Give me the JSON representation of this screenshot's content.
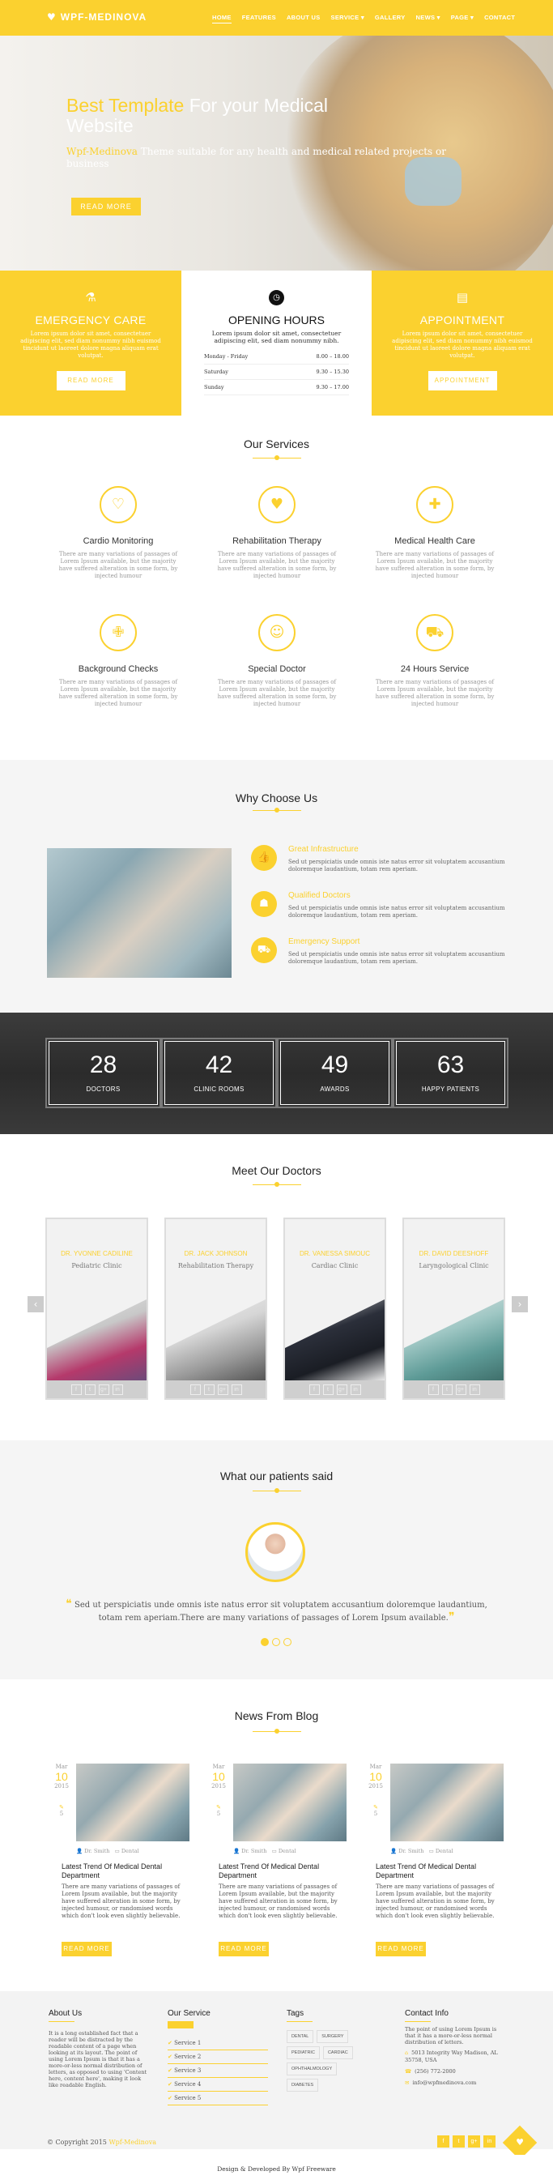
{
  "header": {
    "logo": "WPF-MEDINOVA",
    "nav": [
      "HOME",
      "FEATURES",
      "ABOUT US",
      "SERVICE ▾",
      "GALLERY",
      "NEWS ▾",
      "PAGE ▾",
      "CONTACT"
    ]
  },
  "hero": {
    "title_accent": "Best Template",
    "title_rest": " For your Medical",
    "title_line2": "Website",
    "sub_accent": "Wpf-Medinova",
    "sub_rest": " Theme suitable for any health and medical related projects or business",
    "button": "READ MORE"
  },
  "emergency": {
    "title": "EMERGENCY CARE",
    "text": "Lorem ipsum dolor sit amet, consectetuer adipiscing elit, sed diam nonummy nibh euismod tincidunt ut laoreet dolore magna aliquam erat volutpat.",
    "button": "READ MORE"
  },
  "hours": {
    "title": "OPENING HOURS",
    "text": "Lorem ipsum dolor sit amet, consectetuer adipiscing elit, sed diam nonummy nibh.",
    "rows": [
      {
        "day": "Monday - Friday",
        "time": "8.00 – 18.00"
      },
      {
        "day": "Saturday",
        "time": "9.30 – 15.30"
      },
      {
        "day": "Sunday",
        "time": "9.30 – 17.00"
      }
    ]
  },
  "appointment": {
    "title": "APPOINTMENT",
    "text": "Lorem ipsum dolor sit amet, consectetuer adipiscing elit, sed diam nonummy nibh euismod tincidunt ut laoreet dolore magna aliquam erat volutpat.",
    "button": "APPOINTMENT"
  },
  "services": {
    "title": "Our Services",
    "items": [
      {
        "name": "Cardio Monitoring",
        "text": "There are many variations of passages of Lorem Ipsum available, but the majority have suffered alteration in some form, by injected humour"
      },
      {
        "name": "Rehabilitation Therapy",
        "text": "There are many variations of passages of Lorem Ipsum available, but the majority have suffered alteration in some form, by injected humour"
      },
      {
        "name": "Medical Health Care",
        "text": "There are many variations of passages of Lorem Ipsum available, but the majority have suffered alteration in some form, by injected humour"
      },
      {
        "name": "Background Checks",
        "text": "There are many variations of passages of Lorem Ipsum available, but the majority have suffered alteration in some form, by injected humour"
      },
      {
        "name": "Special Doctor",
        "text": "There are many variations of passages of Lorem Ipsum available, but the majority have suffered alteration in some form, by injected humour"
      },
      {
        "name": "24 Hours Service",
        "text": "There are many variations of passages of Lorem Ipsum available, but the majority have suffered alteration in some form, by injected humour"
      }
    ]
  },
  "why": {
    "title": "Why Choose Us",
    "items": [
      {
        "title": "Great Infrastructure",
        "text": "Sed ut perspiciatis unde omnis iste natus error sit voluptatem accusantium doloremque laudantium, totam rem aperiam."
      },
      {
        "title": "Qualified Doctors",
        "text": "Sed ut perspiciatis unde omnis iste natus error sit voluptatem accusantium doloremque laudantium, totam rem aperiam."
      },
      {
        "title": "Emergency Support",
        "text": "Sed ut perspiciatis unde omnis iste natus error sit voluptatem accusantium doloremque laudantium, totam rem aperiam."
      }
    ]
  },
  "stats": [
    {
      "num": "28",
      "label": "DOCTORS"
    },
    {
      "num": "42",
      "label": "CLINIC ROOMS"
    },
    {
      "num": "49",
      "label": "AWARDS"
    },
    {
      "num": "63",
      "label": "HAPPY PATIENTS"
    }
  ],
  "doctors": {
    "title": "Meet Our Doctors",
    "items": [
      {
        "name": "DR. YVONNE CADILINE",
        "spec": "Pediatric Clinic"
      },
      {
        "name": "DR. JACK JOHNSON",
        "spec": "Rehabilitation Therapy"
      },
      {
        "name": "DR. VANESSA SIMOUC",
        "spec": "Cardiac Clinic"
      },
      {
        "name": "DR. DAVID DEESHOFF",
        "spec": "Laryngological Clinic"
      }
    ],
    "social": [
      "f",
      "t",
      "g+",
      "in"
    ]
  },
  "testimonials": {
    "title": "What our patients said",
    "quote": "Sed ut perspiciatis unde omnis iste natus error sit voluptatem accusantium doloremque laudantium, totam rem aperiam.There are many variations of passages of Lorem Ipsum available."
  },
  "blog": {
    "title": "News From Blog",
    "posts": [
      {
        "month": "Mar",
        "day": "10",
        "year": "2015",
        "comments": "5",
        "author": "Dr. Smith",
        "cat": "Dental",
        "title": "Latest Trend Of Medical Dental Department",
        "text": "There are many variations of passages of Lorem Ipsum available, but the majority have suffered alteration in some form, by injected humour, or randomised words which don't look even slightly believable.",
        "button": "READ MORE"
      },
      {
        "month": "Mar",
        "day": "10",
        "year": "2015",
        "comments": "5",
        "author": "Dr. Smith",
        "cat": "Dental",
        "title": "Latest Trend Of Medical Dental Department",
        "text": "There are many variations of passages of Lorem Ipsum available, but the majority have suffered alteration in some form, by injected humour, or randomised words which don't look even slightly believable.",
        "button": "READ MORE"
      },
      {
        "month": "Mar",
        "day": "10",
        "year": "2015",
        "comments": "5",
        "author": "Dr. Smith",
        "cat": "Dental",
        "title": "Latest Trend Of Medical Dental Department",
        "text": "There are many variations of passages of Lorem Ipsum available, but the majority have suffered alteration in some form, by injected humour, or randomised words which don't look even slightly believable.",
        "button": "READ MORE"
      }
    ]
  },
  "footer": {
    "about_title": "About Us",
    "about_text": "It is a long established fact that a reader will be distracted by the readable content of a page when looking at its layout. The point of using Lorem Ipsum is that it has a more-or-less normal distribution of letters, as opposed to using 'Content here, content here', making it look like readable English.",
    "service_title": "Our Service",
    "services": [
      "Service 1",
      "Service 2",
      "Service 3",
      "Service 4",
      "Service 5"
    ],
    "tags_title": "Tags",
    "tags": [
      "DENTAL",
      "SURGERY",
      "PEDIATRIC",
      "CARDIAC",
      "OPHTHALMOLOGY",
      "DIABETES"
    ],
    "contact_title": "Contact Info",
    "contact_text": "The point of using Lorem Ipsum is that it has a more-or-less normal distribution of letters.",
    "address": "5013 Integrity Way Madison, AL 35758, USA",
    "phone": "(256) 772-2000",
    "email": "info@wpfmedinova.com",
    "copyright": "© Copyright 2015",
    "copyright_brand": "Wpf-Medinova",
    "social": [
      "f",
      "t",
      "g+",
      "in"
    ],
    "credit": "Design & Developed By Wpf Freeware"
  }
}
